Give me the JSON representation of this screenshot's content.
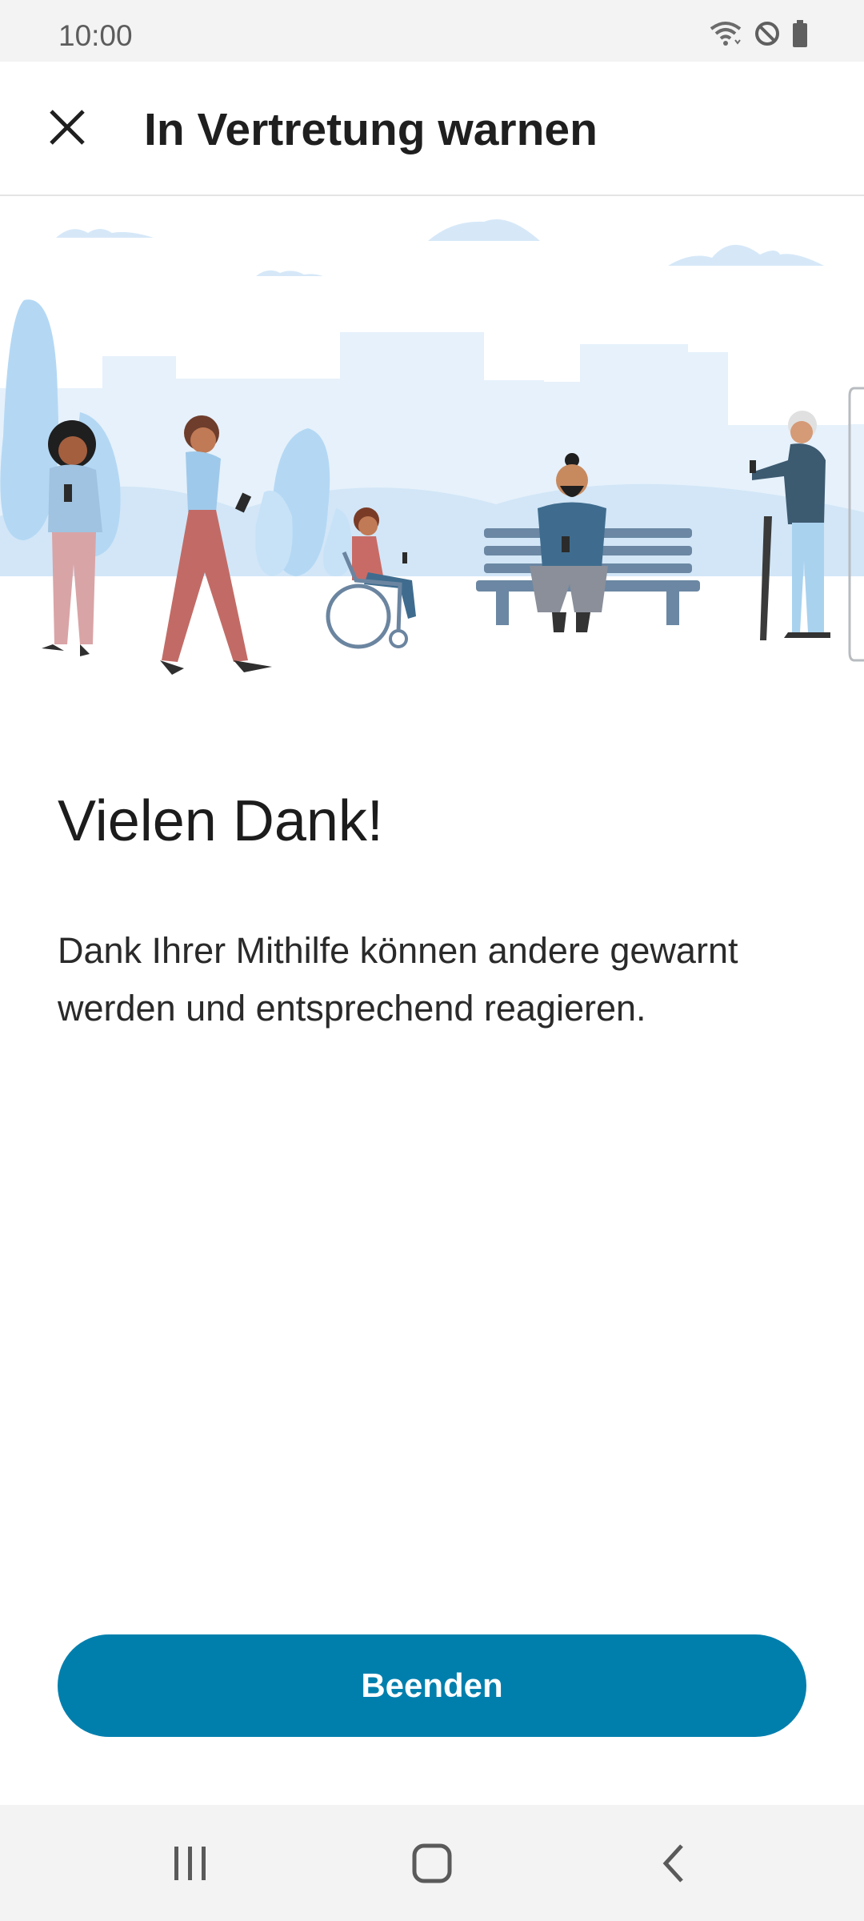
{
  "status_bar": {
    "time": "10:00",
    "icons": [
      "wifi-icon",
      "do-not-disturb-icon",
      "battery-icon"
    ]
  },
  "app_bar": {
    "close_icon": "close-icon",
    "title": "In Vertretung warnen"
  },
  "illustration": {
    "name": "people-in-park-illustration"
  },
  "content": {
    "headline": "Vielen Dank!",
    "body": "Dank Ihrer Mithilfe können andere gewarnt werden und entsprechend reagieren."
  },
  "actions": {
    "primary_label": "Beenden"
  },
  "nav_bar": {
    "icons": [
      "recent-apps-icon",
      "home-icon",
      "back-icon"
    ]
  },
  "colors": {
    "primary": "#007fad",
    "status_bar_bg": "#f3f3f3",
    "illustration_sky": "#e6f1fb"
  }
}
